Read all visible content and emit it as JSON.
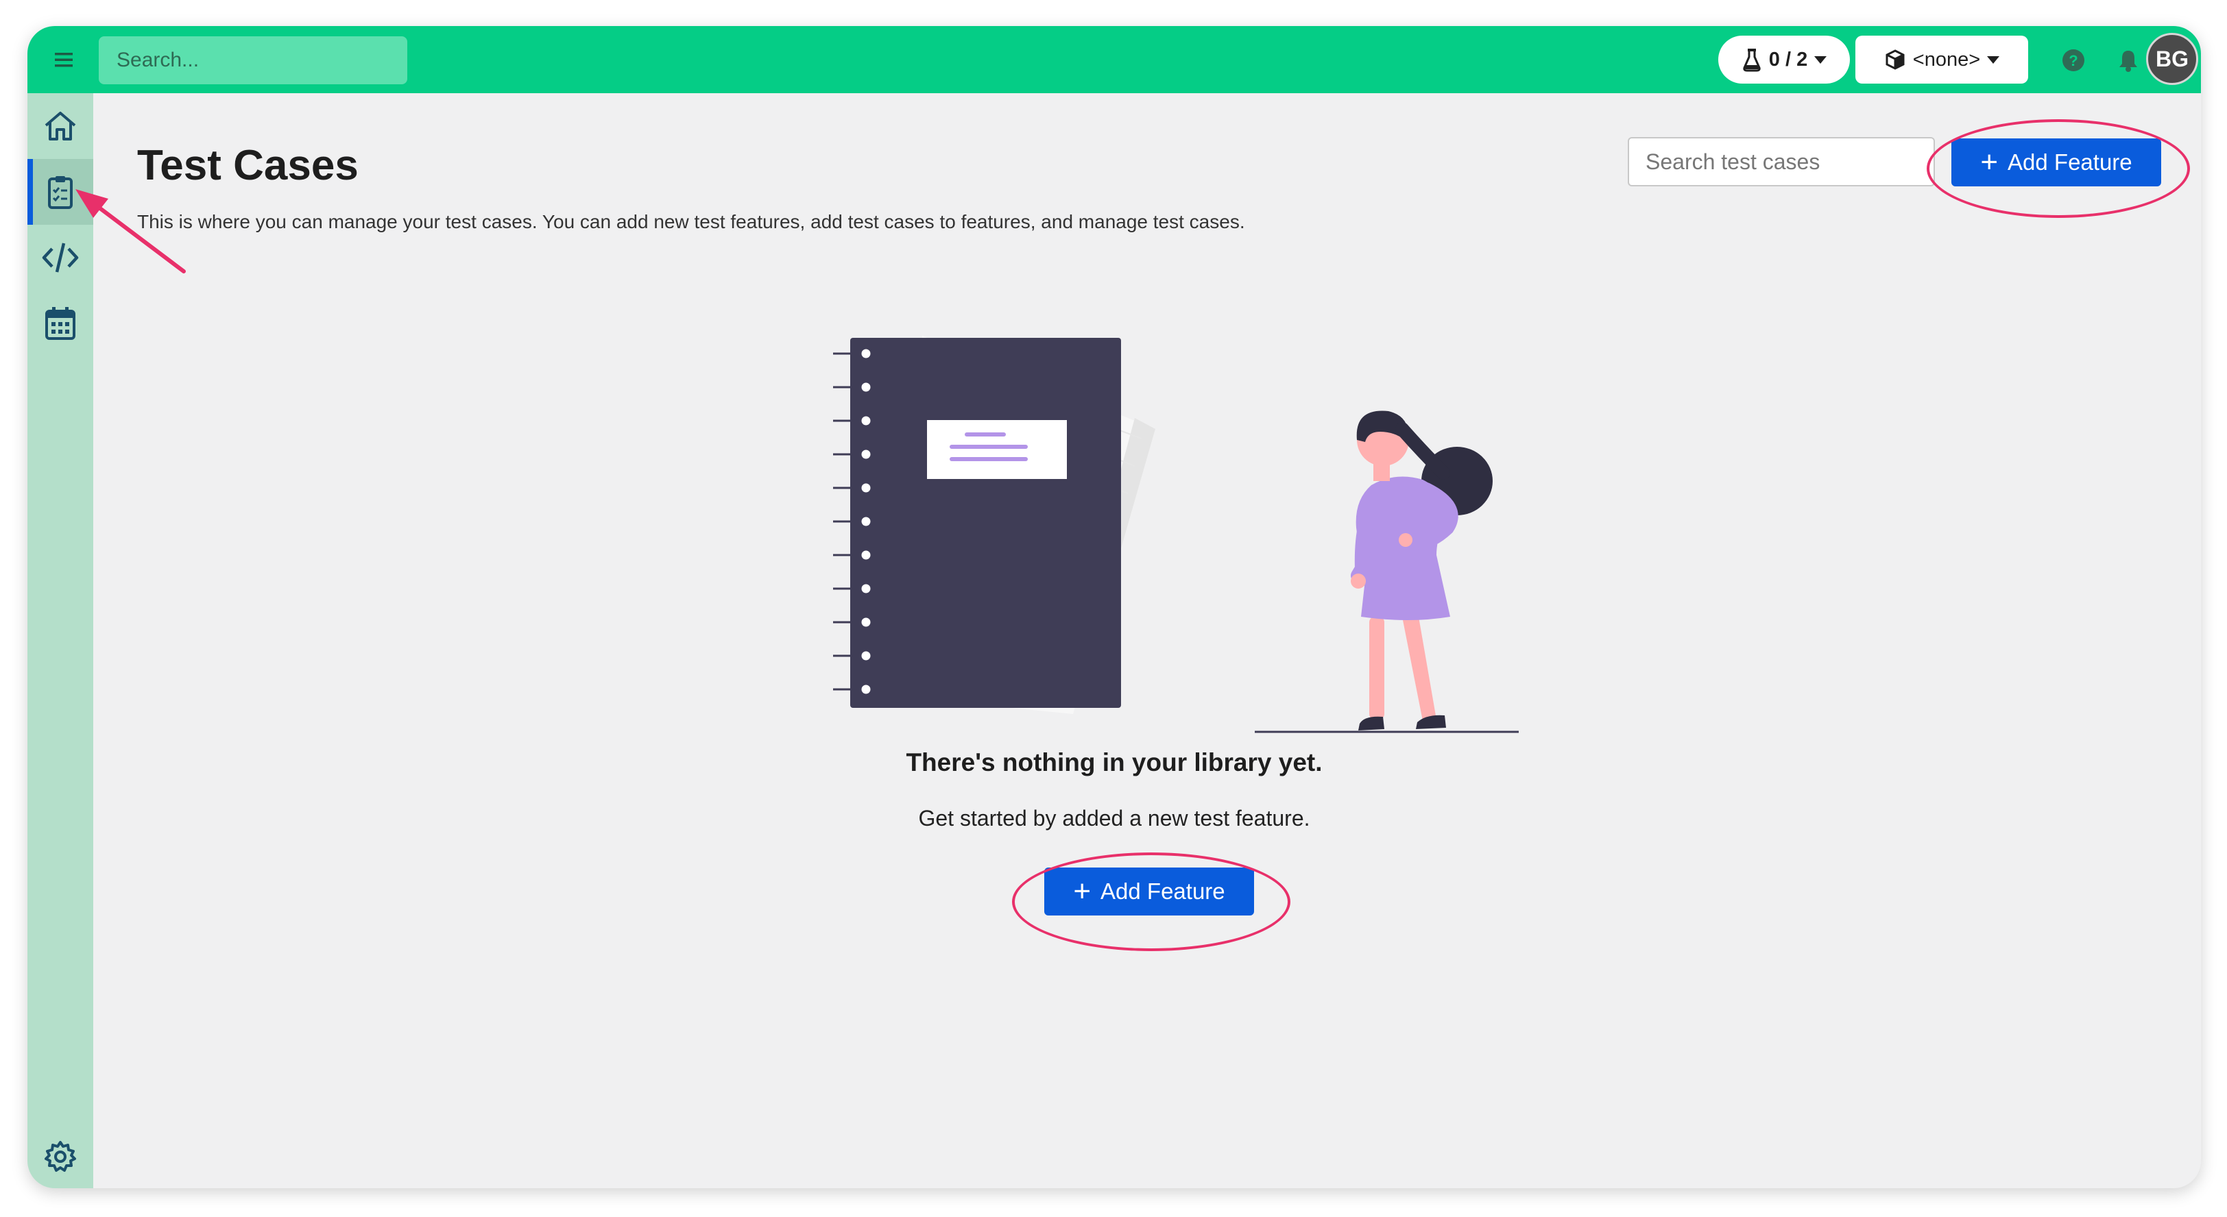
{
  "topbar": {
    "search_placeholder": "Search...",
    "quota_label": "0 / 2",
    "env_label": "<none>",
    "avatar_initials": "BG"
  },
  "sidebar": {
    "items": [
      {
        "name": "home",
        "icon": "home-icon"
      },
      {
        "name": "test-cases",
        "icon": "clipboard-icon",
        "active": true
      },
      {
        "name": "code",
        "icon": "code-icon"
      },
      {
        "name": "schedule",
        "icon": "calendar-icon"
      },
      {
        "name": "settings",
        "icon": "gear-icon"
      }
    ]
  },
  "main": {
    "title": "Test Cases",
    "description": "This is where you can manage your test cases. You can add new test features, add test cases to features, and manage test cases.",
    "search_placeholder": "Search test cases",
    "add_feature_label": "Add Feature",
    "empty_title": "There's nothing in your library yet.",
    "empty_subtitle": "Get started by added a new test feature.",
    "empty_add_feature_label": "Add Feature"
  },
  "colors": {
    "topbar": "#05cd86",
    "sidebar": "#b4dfca",
    "primary": "#0a5cdc",
    "highlight": "#e8306a"
  }
}
